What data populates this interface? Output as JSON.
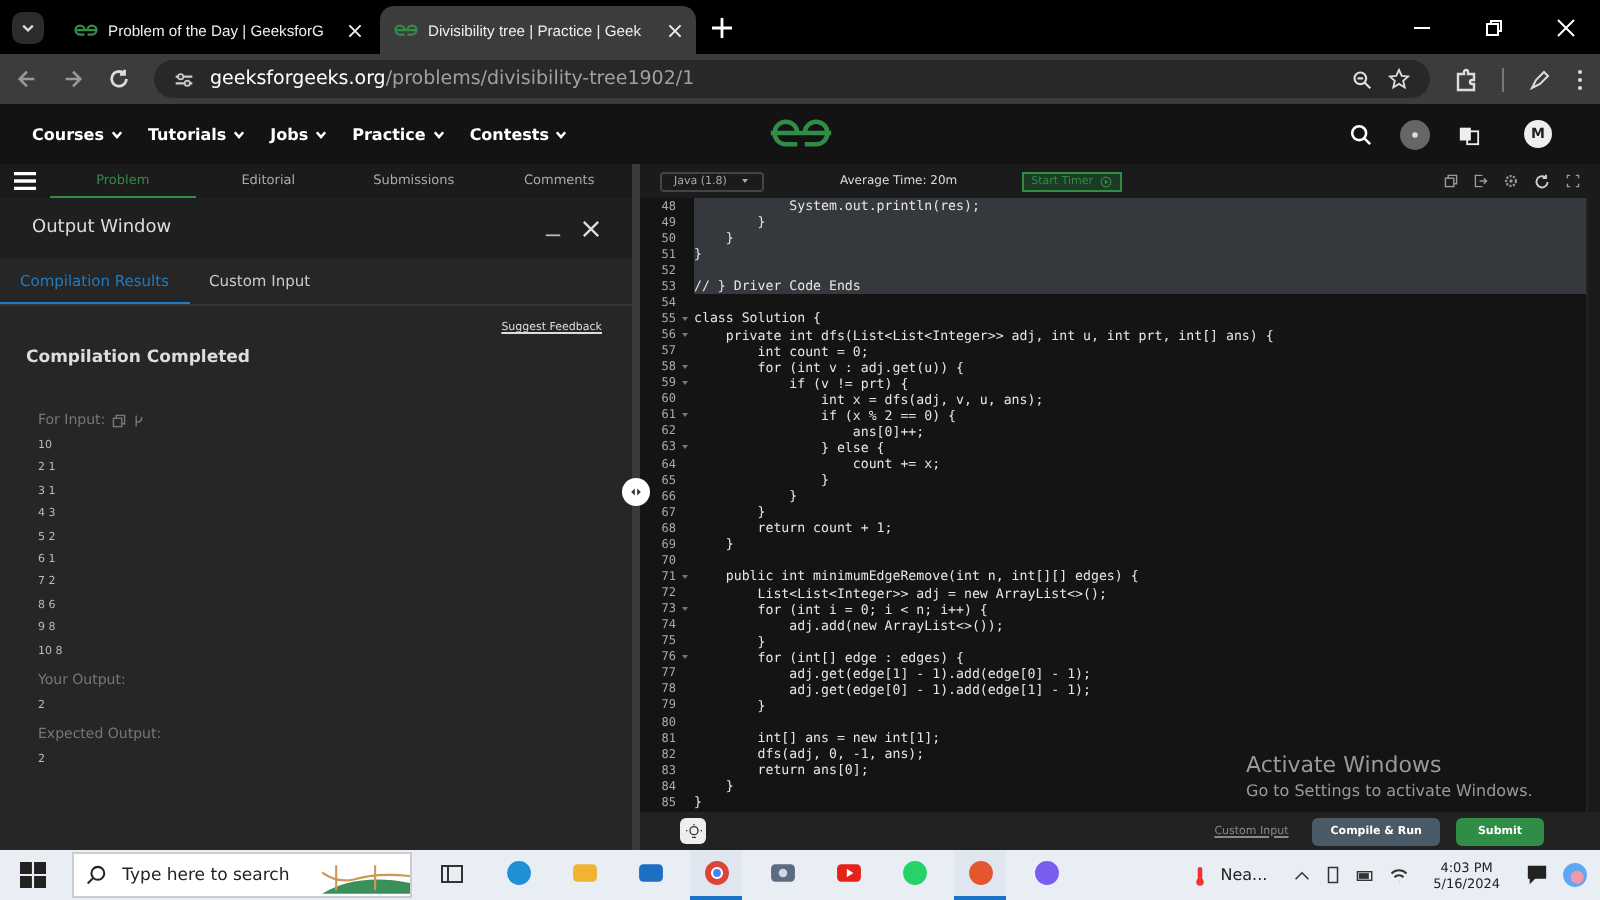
{
  "browser": {
    "tabs": [
      {
        "title": "Problem of the Day | GeeksforG",
        "selected": false
      },
      {
        "title": "Divisibility tree | Practice | Geek",
        "selected": true
      }
    ],
    "address": {
      "domain": "geeksforgeeks.org",
      "path": "/problems/divisibility-tree1902/1"
    }
  },
  "site_nav": {
    "items": [
      "Courses",
      "Tutorials",
      "Jobs",
      "Practice",
      "Contests"
    ],
    "avatar": "M"
  },
  "problem_tabs": [
    {
      "label": "Problem",
      "selected": true
    },
    {
      "label": "Editorial",
      "selected": false
    },
    {
      "label": "Submissions",
      "selected": false
    },
    {
      "label": "Comments",
      "selected": false
    }
  ],
  "output_window": {
    "title": "Output Window",
    "tabs": [
      {
        "label": "Compilation Results",
        "selected": true
      },
      {
        "label": "Custom Input",
        "selected": false
      }
    ],
    "feedback_link": "Suggest Feedback",
    "status": "Compilation Completed",
    "input_label": "For Input:",
    "input_lines": [
      "10",
      "2 1",
      "3 1",
      "4 3",
      "5 2",
      "6 1",
      "7 2",
      "8 6",
      "9 8",
      "10 8"
    ],
    "your_output_label": "Your Output:",
    "your_output": "2",
    "expected_label": "Expected Output:",
    "expected": "2"
  },
  "editor": {
    "language": "Java (1.8)",
    "average_time": "Average Time: 20m",
    "timer_button": "Start Timer",
    "lines": [
      {
        "number": "48",
        "text": "            System.out.println(res);",
        "highlighted": true,
        "fold": false
      },
      {
        "number": "49",
        "text": "        }",
        "highlighted": true,
        "fold": false
      },
      {
        "number": "50",
        "text": "    }",
        "highlighted": true,
        "fold": false
      },
      {
        "number": "51",
        "text": "}",
        "highlighted": true,
        "fold": false
      },
      {
        "number": "52",
        "highlighted": true,
        "fold": false
      },
      {
        "number": "53",
        "text": "// } Driver Code Ends",
        "highlighted": true,
        "fold": false
      },
      {
        "number": "54",
        "highlighted": false,
        "fold": false
      },
      {
        "number": "55",
        "text": "class Solution {",
        "highlighted": false,
        "fold": true
      },
      {
        "number": "56",
        "text": "    private int dfs(List<List<Integer>> adj, int u, int prt, int[] ans) {",
        "highlighted": false,
        "fold": true
      },
      {
        "number": "57",
        "text": "        int count = 0;",
        "highlighted": false,
        "fold": false
      },
      {
        "number": "58",
        "text": "        for (int v : adj.get(u)) {",
        "highlighted": false,
        "fold": true
      },
      {
        "number": "59",
        "text": "            if (v != prt) {",
        "highlighted": false,
        "fold": true
      },
      {
        "number": "60",
        "text": "                int x = dfs(adj, v, u, ans);",
        "highlighted": false,
        "fold": false
      },
      {
        "number": "61",
        "text": "                if (x % 2 == 0) {",
        "highlighted": false,
        "fold": true
      },
      {
        "number": "62",
        "text": "                    ans[0]++;",
        "highlighted": false,
        "fold": false
      },
      {
        "number": "63",
        "text": "                } else {",
        "highlighted": false,
        "fold": true
      },
      {
        "number": "64",
        "text": "                    count += x;",
        "highlighted": false,
        "fold": false
      },
      {
        "number": "65",
        "text": "                }",
        "highlighted": false,
        "fold": false
      },
      {
        "number": "66",
        "text": "            }",
        "highlighted": false,
        "fold": false
      },
      {
        "number": "67",
        "text": "        }",
        "highlighted": false,
        "fold": false
      },
      {
        "number": "68",
        "text": "        return count + 1;",
        "highlighted": false,
        "fold": false
      },
      {
        "number": "69",
        "text": "    }",
        "highlighted": false,
        "fold": false
      },
      {
        "number": "70",
        "highlighted": false,
        "fold": false
      },
      {
        "number": "71",
        "text": "    public int minimumEdgeRemove(int n, int[][] edges) {",
        "highlighted": false,
        "fold": true
      },
      {
        "number": "72",
        "text": "        List<List<Integer>> adj = new ArrayList<>();",
        "highlighted": false,
        "fold": false
      },
      {
        "number": "73",
        "text": "        for (int i = 0; i < n; i++) {",
        "highlighted": false,
        "fold": true
      },
      {
        "number": "74",
        "text": "            adj.add(new ArrayList<>());",
        "highlighted": false,
        "fold": false
      },
      {
        "number": "75",
        "text": "        }",
        "highlighted": false,
        "fold": false
      },
      {
        "number": "76",
        "text": "        for (int[] edge : edges) {",
        "highlighted": false,
        "fold": true
      },
      {
        "number": "77",
        "text": "            adj.get(edge[1] - 1).add(edge[0] - 1);",
        "highlighted": false,
        "fold": false
      },
      {
        "number": "78",
        "text": "            adj.get(edge[0] - 1).add(edge[1] - 1);",
        "highlighted": false,
        "fold": false
      },
      {
        "number": "79",
        "text": "        }",
        "highlighted": false,
        "fold": false
      },
      {
        "number": "80",
        "highlighted": false,
        "fold": false
      },
      {
        "number": "81",
        "text": "        int[] ans = new int[1];",
        "highlighted": false,
        "fold": false
      },
      {
        "number": "82",
        "text": "        dfs(adj, 0, -1, ans);",
        "highlighted": false,
        "fold": false
      },
      {
        "number": "83",
        "text": "        return ans[0];",
        "highlighted": false,
        "fold": false
      },
      {
        "number": "84",
        "text": "    }",
        "highlighted": false,
        "fold": false
      },
      {
        "number": "85",
        "text": "}",
        "highlighted": false,
        "fold": false
      }
    ],
    "custom_input_link": "Custom Input",
    "compile_button": "Compile & Run",
    "submit_button": "Submit"
  },
  "activation_notice": {
    "title": "Activate Windows",
    "subtitle": "Go to Settings to activate Windows."
  },
  "taskbar": {
    "search_placeholder": "Type here to search",
    "apps": [
      {
        "kind": "taskview",
        "active": false
      },
      {
        "kind": "edge",
        "active": false
      },
      {
        "kind": "files",
        "active": false
      },
      {
        "kind": "mail",
        "active": false
      },
      {
        "kind": "chrome",
        "active": true
      },
      {
        "kind": "camera",
        "active": false
      },
      {
        "kind": "youtube",
        "active": false
      },
      {
        "kind": "whatsapp",
        "active": false
      },
      {
        "kind": "brave",
        "active": true
      },
      {
        "kind": "copilot",
        "active": false
      }
    ],
    "weather": "Nea...",
    "time": "4:03 PM",
    "date": "5/16/2024"
  }
}
